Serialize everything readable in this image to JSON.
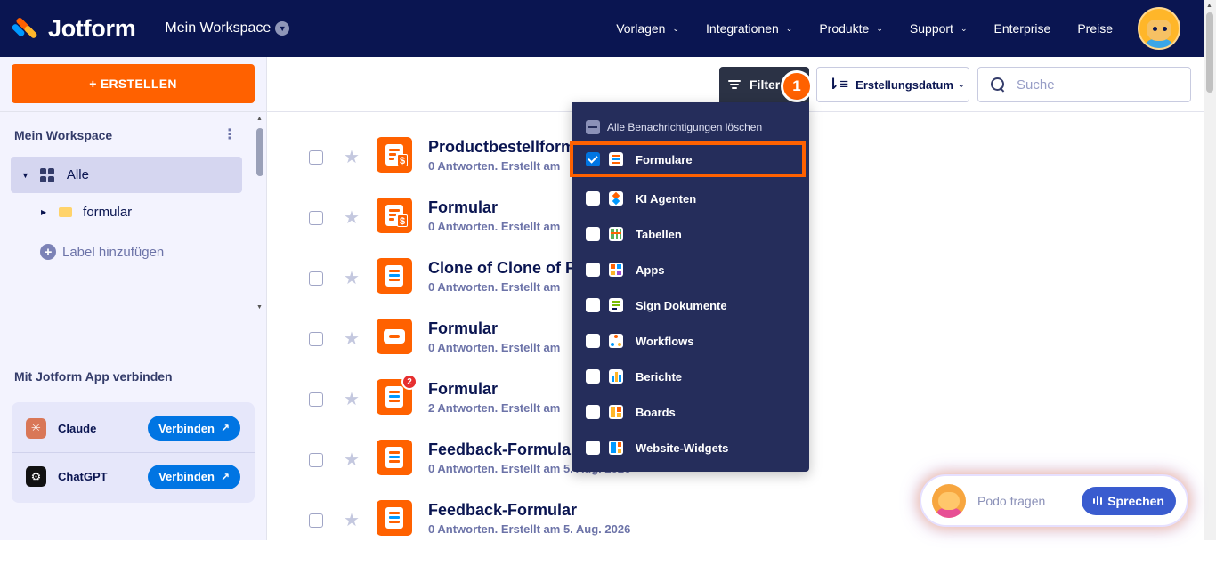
{
  "topbar": {
    "brand": "Jotform",
    "workspace": "Mein Workspace",
    "nav": [
      {
        "label": "Vorlagen",
        "has_dropdown": true
      },
      {
        "label": "Integrationen",
        "has_dropdown": true
      },
      {
        "label": "Produkte",
        "has_dropdown": true
      },
      {
        "label": "Support",
        "has_dropdown": true
      },
      {
        "label": "Enterprise",
        "has_dropdown": false
      },
      {
        "label": "Preise",
        "has_dropdown": false
      }
    ]
  },
  "sidebar": {
    "create_label": "+ ERSTELLEN",
    "workspace_title": "Mein Workspace",
    "more_icon": "⋮",
    "all_label": "Alle",
    "folder_label": "formular",
    "add_label": "Label hinzufügen",
    "app_connect_title": "Mit Jotform App verbinden",
    "apps": [
      {
        "name": "Claude",
        "button": "Verbinden"
      },
      {
        "name": "ChatGPT",
        "button": "Verbinden"
      }
    ]
  },
  "toolbar": {
    "filter_label": "Filter",
    "step_badge": "1",
    "sort_label": "Erstellungsdatum",
    "search_placeholder": "Suche"
  },
  "forms": [
    {
      "title": "Productbestellform",
      "meta": "0 Antworten. Erstellt am",
      "icon": "payment-form-icon",
      "notifications": ""
    },
    {
      "title": "Formular",
      "meta": "0 Antworten. Erstellt am",
      "icon": "payment-form-icon",
      "notifications": ""
    },
    {
      "title": "Clone of Clone of Fo",
      "meta": "0 Antworten. Erstellt am",
      "icon": "form-icon",
      "notifications": ""
    },
    {
      "title": "Formular",
      "meta": "0 Antworten. Erstellt am",
      "icon": "card-form-icon",
      "notifications": ""
    },
    {
      "title": "Formular",
      "meta": "2 Antworten. Erstellt am",
      "icon": "form-icon",
      "notifications": "2"
    },
    {
      "title": "Feedback-Formular",
      "meta": "0 Antworten. Erstellt am 5. Aug. 2026",
      "icon": "form-icon",
      "notifications": ""
    },
    {
      "title": "Feedback-Formular",
      "meta": "0 Antworten. Erstellt am 5. Aug. 2026",
      "icon": "form-icon",
      "notifications": ""
    }
  ],
  "filter_menu": {
    "clear_label": "Alle Benachrichtigungen löschen",
    "items": [
      {
        "label": "Formulare",
        "checked": true,
        "icon": "forms-icon"
      },
      {
        "label": "KI Agenten",
        "checked": false,
        "icon": "ai-agent-icon"
      },
      {
        "label": "Tabellen",
        "checked": false,
        "icon": "tables-icon"
      },
      {
        "label": "Apps",
        "checked": false,
        "icon": "apps-icon"
      },
      {
        "label": "Sign Dokumente",
        "checked": false,
        "icon": "sign-icon"
      },
      {
        "label": "Workflows",
        "checked": false,
        "icon": "workflows-icon"
      },
      {
        "label": "Berichte",
        "checked": false,
        "icon": "reports-icon"
      },
      {
        "label": "Boards",
        "checked": false,
        "icon": "boards-icon"
      },
      {
        "label": "Website-Widgets",
        "checked": false,
        "icon": "widgets-icon"
      }
    ]
  },
  "podo": {
    "ask_label": "Podo fragen",
    "speak_label": "Sprechen"
  },
  "colors": {
    "navy": "#0a1551",
    "orange": "#ff6100",
    "blue": "#0075e3",
    "menu_bg": "#252d5b"
  }
}
